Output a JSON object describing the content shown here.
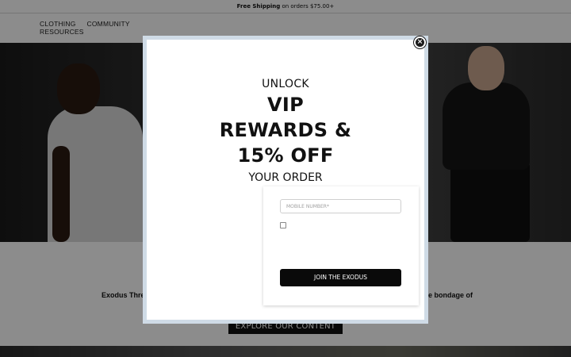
{
  "announcement": {
    "bold": "Free Shipping",
    "rest": " on orders $75.00+"
  },
  "nav": {
    "items": [
      "CLOTHING",
      "COMMUNITY",
      "RESOURCES"
    ]
  },
  "intro": {
    "text_left": "Exodus Threa",
    "text_right": "e bondage of",
    "cta_label": "EXPLORE OUR CONTENT"
  },
  "popup": {
    "close_glyph": "×",
    "line_unlock": "UNLOCK",
    "line_vip": "VIP",
    "line_rewards": "REWARDS &",
    "line_off": "15% OFF",
    "line_order": "YOUR ORDER",
    "mobile_placeholder": "MOBILE NUMBER*",
    "mobile_value": "",
    "consent_checked": false,
    "submit_label": "JOIN THE EXODUS",
    "frame_color": "#cfdbe6",
    "button_color": "#0a0a0a"
  }
}
